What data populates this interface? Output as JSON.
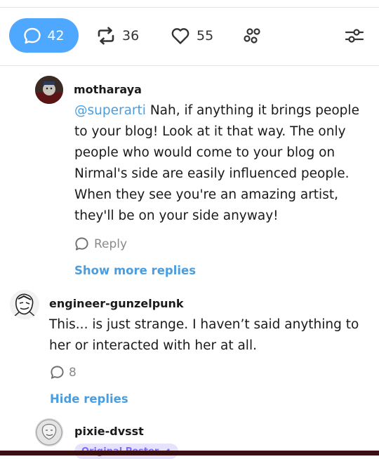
{
  "actions": {
    "comments_count": "42",
    "reblogs_count": "36",
    "likes_count": "55"
  },
  "comments": [
    {
      "username": "motharaya",
      "mention": "@superarti",
      "text": " Nah, if anything it brings people to your blog! Look at it that way. The only people who would come to your blog on Nirmal's side are easily influenced people. When they see you're an amazing artist, they'll be on your side anyway!",
      "reply_label": "Reply",
      "show_more_label": "Show more replies"
    },
    {
      "username": "engineer-gunzelpunk",
      "text": "This... is just strange. I haven’t said anything to her or interacted with her at all.",
      "replies_count": "8",
      "hide_label": "Hide replies"
    },
    {
      "username": "pixie-dvsst",
      "badge": "Original Poster"
    }
  ],
  "colors": {
    "accent_blue": "#4ea8ff",
    "link_blue": "#4a9ee0",
    "badge_purple": "#7e68ff"
  }
}
